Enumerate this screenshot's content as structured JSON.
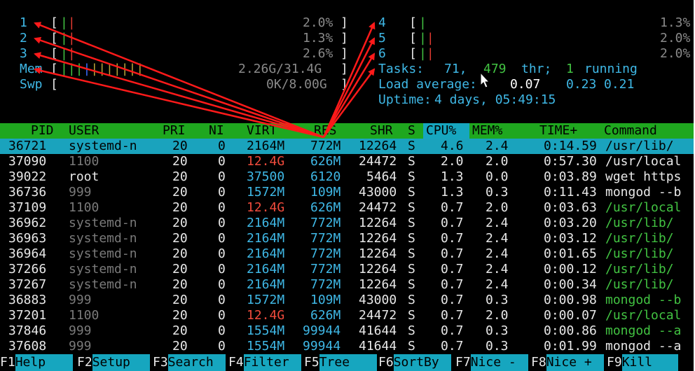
{
  "meters": {
    "cpus_left": [
      {
        "num": "1",
        "bar": "||",
        "pct": "2.0%"
      },
      {
        "num": "2",
        "bar": "||",
        "pct": "1.3%"
      },
      {
        "num": "3",
        "bar": "||",
        "pct": "2.6%"
      }
    ],
    "cpus_right": [
      {
        "num": "4",
        "bar": "|",
        "pct": "1.3%"
      },
      {
        "num": "5",
        "bar": "||",
        "pct": "2.0%"
      },
      {
        "num": "6",
        "bar": "||",
        "pct": "2.0%"
      }
    ],
    "mem": {
      "label": "Mem",
      "bar": "|||||||||||",
      "value": "2.26G/31.4G"
    },
    "swp": {
      "label": "Swp",
      "bar": "",
      "value": "0K/8.00G"
    }
  },
  "summary": {
    "tasks_label": "Tasks:",
    "tasks_count": "71,",
    "threads": "479",
    "threads_label": "thr;",
    "running_count": "1",
    "running_label": "running",
    "load_label": "Load average:",
    "load_1": "0.07",
    "load_5": "0.23",
    "load_15": "0.21",
    "uptime_label": "Uptime:",
    "uptime_value": "4 days, 05:49:15"
  },
  "columns": [
    "PID",
    "USER",
    "PRI",
    "NI",
    "VIRT",
    "RES",
    "SHR",
    "S",
    "CPU%",
    "MEM%",
    "TIME+",
    "Command"
  ],
  "processes": [
    {
      "pid": "36721",
      "user": "systemd-n",
      "pri": "20",
      "ni": "0",
      "virt": "2164M",
      "res": "772M",
      "shr": "12264",
      "s": "S",
      "cpu": "4.6",
      "mem": "2.4",
      "time": "0:14.59",
      "cmd": "/usr/lib/",
      "selected": true,
      "thread": false,
      "userdim": false,
      "virtred": false
    },
    {
      "pid": "37090",
      "user": "1100",
      "pri": "20",
      "ni": "0",
      "virt": "12.4G",
      "res": "626M",
      "shr": "24472",
      "s": "S",
      "cpu": "2.0",
      "mem": "2.0",
      "time": "0:57.30",
      "cmd": "/usr/local",
      "selected": false,
      "thread": false,
      "userdim": true,
      "virtred": true
    },
    {
      "pid": "39022",
      "user": "root",
      "pri": "20",
      "ni": "0",
      "virt": "37500",
      "res": "6120",
      "shr": "5464",
      "s": "S",
      "cpu": "1.3",
      "mem": "0.0",
      "time": "0:03.89",
      "cmd": "wget https",
      "selected": false,
      "thread": false,
      "userdim": false,
      "virtred": false
    },
    {
      "pid": "36736",
      "user": "999",
      "pri": "20",
      "ni": "0",
      "virt": "1572M",
      "res": "109M",
      "shr": "43000",
      "s": "S",
      "cpu": "1.3",
      "mem": "0.3",
      "time": "0:11.43",
      "cmd": "mongod --b",
      "selected": false,
      "thread": false,
      "userdim": true,
      "virtred": false
    },
    {
      "pid": "37109",
      "user": "1100",
      "pri": "20",
      "ni": "0",
      "virt": "12.4G",
      "res": "626M",
      "shr": "24472",
      "s": "S",
      "cpu": "0.7",
      "mem": "2.0",
      "time": "0:03.63",
      "cmd": "/usr/local",
      "selected": false,
      "thread": true,
      "userdim": true,
      "virtred": true
    },
    {
      "pid": "36962",
      "user": "systemd-n",
      "pri": "20",
      "ni": "0",
      "virt": "2164M",
      "res": "772M",
      "shr": "12264",
      "s": "S",
      "cpu": "0.7",
      "mem": "2.4",
      "time": "0:03.20",
      "cmd": "/usr/lib/",
      "selected": false,
      "thread": true,
      "userdim": true,
      "virtred": false
    },
    {
      "pid": "36963",
      "user": "systemd-n",
      "pri": "20",
      "ni": "0",
      "virt": "2164M",
      "res": "772M",
      "shr": "12264",
      "s": "S",
      "cpu": "0.7",
      "mem": "2.4",
      "time": "0:03.12",
      "cmd": "/usr/lib/",
      "selected": false,
      "thread": true,
      "userdim": true,
      "virtred": false
    },
    {
      "pid": "36964",
      "user": "systemd-n",
      "pri": "20",
      "ni": "0",
      "virt": "2164M",
      "res": "772M",
      "shr": "12264",
      "s": "S",
      "cpu": "0.7",
      "mem": "2.4",
      "time": "0:01.65",
      "cmd": "/usr/lib/",
      "selected": false,
      "thread": true,
      "userdim": true,
      "virtred": false
    },
    {
      "pid": "37266",
      "user": "systemd-n",
      "pri": "20",
      "ni": "0",
      "virt": "2164M",
      "res": "772M",
      "shr": "12264",
      "s": "S",
      "cpu": "0.7",
      "mem": "2.4",
      "time": "0:00.12",
      "cmd": "/usr/lib/",
      "selected": false,
      "thread": true,
      "userdim": true,
      "virtred": false
    },
    {
      "pid": "37267",
      "user": "systemd-n",
      "pri": "20",
      "ni": "0",
      "virt": "2164M",
      "res": "772M",
      "shr": "12264",
      "s": "S",
      "cpu": "0.7",
      "mem": "2.4",
      "time": "0:00.34",
      "cmd": "/usr/lib/",
      "selected": false,
      "thread": true,
      "userdim": true,
      "virtred": false
    },
    {
      "pid": "36883",
      "user": "999",
      "pri": "20",
      "ni": "0",
      "virt": "1572M",
      "res": "109M",
      "shr": "43000",
      "s": "S",
      "cpu": "0.7",
      "mem": "0.3",
      "time": "0:00.98",
      "cmd": "mongod --b",
      "selected": false,
      "thread": true,
      "userdim": true,
      "virtred": false
    },
    {
      "pid": "37201",
      "user": "1100",
      "pri": "20",
      "ni": "0",
      "virt": "12.4G",
      "res": "626M",
      "shr": "24472",
      "s": "S",
      "cpu": "0.7",
      "mem": "2.0",
      "time": "0:00.07",
      "cmd": "/usr/local",
      "selected": false,
      "thread": true,
      "userdim": true,
      "virtred": true
    },
    {
      "pid": "37846",
      "user": "999",
      "pri": "20",
      "ni": "0",
      "virt": "1554M",
      "res": "99944",
      "shr": "41644",
      "s": "S",
      "cpu": "0.7",
      "mem": "0.3",
      "time": "0:00.86",
      "cmd": "mongod --a",
      "selected": false,
      "thread": true,
      "userdim": true,
      "virtred": false
    },
    {
      "pid": "37608",
      "user": "999",
      "pri": "20",
      "ni": "0",
      "virt": "1554M",
      "res": "99944",
      "shr": "41644",
      "s": "S",
      "cpu": "0.7",
      "mem": "0.3",
      "time": "0:01.99",
      "cmd": "mongod --a",
      "selected": false,
      "thread": false,
      "userdim": true,
      "virtred": false
    }
  ],
  "footer": [
    {
      "key": "F1",
      "label": "Help"
    },
    {
      "key": "F2",
      "label": "Setup"
    },
    {
      "key": "F3",
      "label": "Search"
    },
    {
      "key": "F4",
      "label": "Filter"
    },
    {
      "key": "F5",
      "label": "Tree"
    },
    {
      "key": "F6",
      "label": "SortBy"
    },
    {
      "key": "F7",
      "label": "Nice -"
    },
    {
      "key": "F8",
      "label": "Nice +"
    },
    {
      "key": "F9",
      "label": "Kill"
    }
  ],
  "colors": {
    "background": "#000000",
    "header": "#1fa71f",
    "selection": "#1aa3bd",
    "annotation": "#ff0000"
  }
}
